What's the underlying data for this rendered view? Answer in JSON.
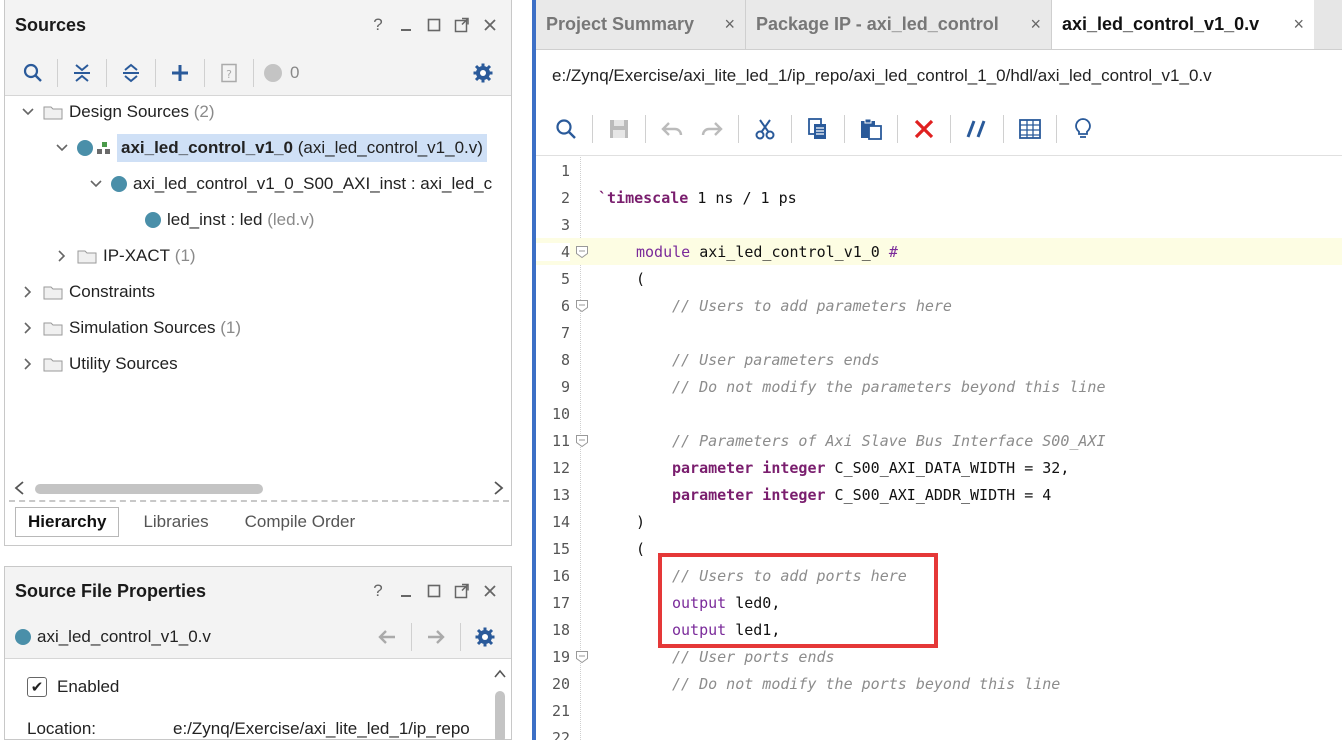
{
  "sources": {
    "title": "Sources",
    "header_controls": [
      "?",
      "minimize",
      "restore",
      "float",
      "close"
    ],
    "toolbar": {
      "badge_count": "0"
    },
    "tree": [
      {
        "label": "Design Sources",
        "count": "(2)",
        "indent": 0,
        "expanded": true
      },
      {
        "label": "axi_led_control_v1_0",
        "suffix": "(axi_led_control_v1_0.v)",
        "indent": 1,
        "selected": true
      },
      {
        "label": "axi_led_control_v1_0_S00_AXI_inst : axi_led_c",
        "indent": 2
      },
      {
        "label": "led_inst : led",
        "suffix": "(led.v)",
        "indent": 3
      },
      {
        "label": "IP-XACT",
        "count": "(1)",
        "indent": 1
      },
      {
        "label": "Constraints",
        "indent": 0
      },
      {
        "label": "Simulation Sources",
        "count": "(1)",
        "indent": 0
      },
      {
        "label": "Utility Sources",
        "indent": 0
      }
    ],
    "tabs": [
      "Hierarchy",
      "Libraries",
      "Compile Order"
    ]
  },
  "properties": {
    "title": "Source File Properties",
    "file": "axi_led_control_v1_0.v",
    "enabled_label": "Enabled",
    "location_label": "Location:",
    "location_value": "e:/Zynq/Exercise/axi_lite_led_1/ip_repo"
  },
  "editor": {
    "tabs": [
      {
        "label": "Project Summary",
        "active": false
      },
      {
        "label": "Package IP - axi_led_control",
        "active": false
      },
      {
        "label": "axi_led_control_v1_0.v",
        "active": true
      }
    ],
    "path": "e:/Zynq/Exercise/axi_lite_led_1/ip_repo/axi_led_control_1_0/hdl/axi_led_control_v1_0.v",
    "lines": [
      {
        "n": "1",
        "tokens": []
      },
      {
        "n": "2",
        "tokens": [
          [
            "kwb",
            "`timescale"
          ],
          [
            "t",
            " 1 ns / 1 ps"
          ]
        ],
        "indent": 0
      },
      {
        "n": "3",
        "tokens": []
      },
      {
        "n": "4",
        "fold": true,
        "hl": true,
        "indent": 1,
        "tokens": [
          [
            "kw",
            "module"
          ],
          [
            "t",
            " axi_led_control_v1_0 "
          ],
          [
            "kw",
            "#"
          ]
        ]
      },
      {
        "n": "5",
        "indent": 1,
        "tokens": [
          [
            "t",
            "("
          ]
        ]
      },
      {
        "n": "6",
        "fold": true,
        "indent": 2,
        "tokens": [
          [
            "cm",
            "// Users to add parameters here"
          ]
        ]
      },
      {
        "n": "7",
        "tokens": []
      },
      {
        "n": "8",
        "indent": 2,
        "tokens": [
          [
            "cm",
            "// User parameters ends"
          ]
        ]
      },
      {
        "n": "9",
        "indent": 2,
        "tokens": [
          [
            "cm",
            "// Do not modify the parameters beyond this line"
          ]
        ]
      },
      {
        "n": "10",
        "tokens": []
      },
      {
        "n": "11",
        "fold": true,
        "indent": 2,
        "tokens": [
          [
            "cm",
            "// Parameters of Axi Slave Bus Interface S00_AXI"
          ]
        ]
      },
      {
        "n": "12",
        "indent": 2,
        "tokens": [
          [
            "kwb",
            "parameter integer"
          ],
          [
            "t",
            " C_S00_AXI_DATA_WIDTH = 32,"
          ]
        ]
      },
      {
        "n": "13",
        "indent": 2,
        "tokens": [
          [
            "kwb",
            "parameter integer"
          ],
          [
            "t",
            " C_S00_AXI_ADDR_WIDTH = 4"
          ]
        ]
      },
      {
        "n": "14",
        "indent": 1,
        "tokens": [
          [
            "t",
            ")"
          ]
        ]
      },
      {
        "n": "15",
        "indent": 1,
        "tokens": [
          [
            "t",
            "("
          ]
        ]
      },
      {
        "n": "16",
        "indent": 2,
        "tokens": [
          [
            "cm",
            "// Users to add ports here"
          ]
        ]
      },
      {
        "n": "17",
        "indent": 2,
        "tokens": [
          [
            "kw",
            "output"
          ],
          [
            "t",
            " led0,"
          ]
        ]
      },
      {
        "n": "18",
        "indent": 2,
        "tokens": [
          [
            "kw",
            "output"
          ],
          [
            "t",
            " led1,"
          ]
        ]
      },
      {
        "n": "19",
        "fold": true,
        "indent": 2,
        "tokens": [
          [
            "cm",
            "// User ports ends"
          ]
        ]
      },
      {
        "n": "20",
        "indent": 2,
        "tokens": [
          [
            "cm",
            "// Do not modify the ports beyond this line"
          ]
        ]
      },
      {
        "n": "21",
        "tokens": []
      },
      {
        "n": "22",
        "tokens": []
      }
    ]
  },
  "colors": {
    "accent": "#3c6fc6",
    "highlight_box": "#e53838",
    "selection": "#cfe0f6"
  }
}
